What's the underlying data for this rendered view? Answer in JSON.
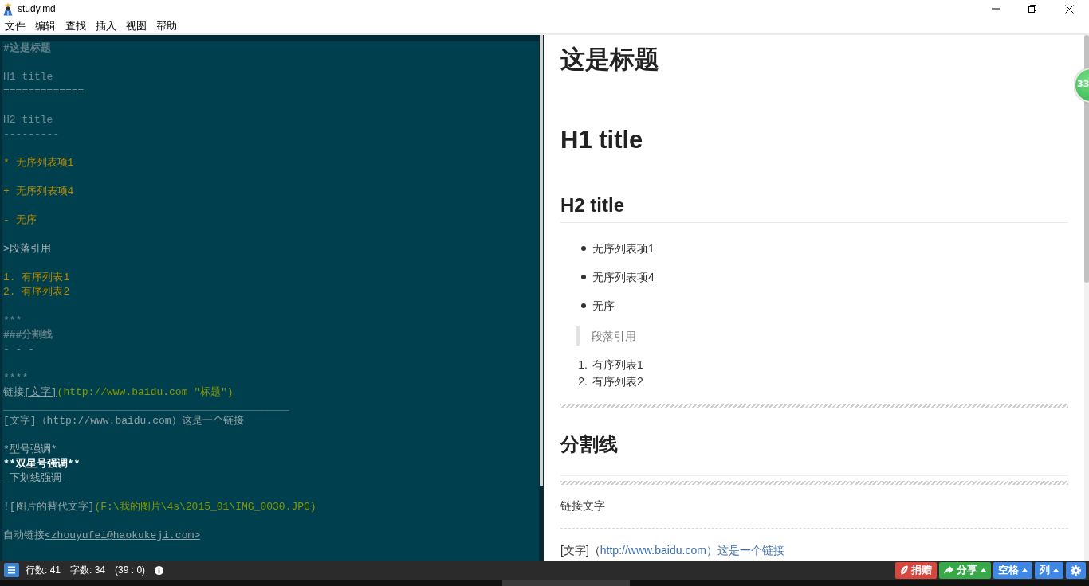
{
  "window": {
    "title": "study.md"
  },
  "menu": [
    "文件",
    "编辑",
    "查找",
    "插入",
    "视图",
    "帮助"
  ],
  "editor": {
    "lines": [
      {
        "kind": "code",
        "segments": [
          {
            "text": "#这是标题",
            "kind": "heading"
          }
        ]
      },
      {
        "kind": "blank"
      },
      {
        "kind": "code",
        "segments": [
          {
            "text": "H1 title",
            "kind": "setext"
          }
        ]
      },
      {
        "kind": "code",
        "segments": [
          {
            "text": "=============",
            "kind": "setext"
          }
        ]
      },
      {
        "kind": "blank"
      },
      {
        "kind": "code",
        "segments": [
          {
            "text": "H2 title",
            "kind": "setext"
          }
        ]
      },
      {
        "kind": "code",
        "segments": [
          {
            "text": "---------",
            "kind": "setext"
          }
        ]
      },
      {
        "kind": "blank"
      },
      {
        "kind": "code",
        "segments": [
          {
            "text": "* 无序列表项1",
            "kind": "list"
          }
        ]
      },
      {
        "kind": "blank"
      },
      {
        "kind": "code",
        "segments": [
          {
            "text": "+ 无序列表项4",
            "kind": "list"
          }
        ]
      },
      {
        "kind": "blank"
      },
      {
        "kind": "code",
        "segments": [
          {
            "text": "- 无序",
            "kind": "list"
          }
        ]
      },
      {
        "kind": "blank"
      },
      {
        "kind": "code",
        "segments": [
          {
            "text": ">段落引用",
            "kind": "quote"
          }
        ]
      },
      {
        "kind": "blank"
      },
      {
        "kind": "code",
        "segments": [
          {
            "text": "1. 有序列表1",
            "kind": "list"
          }
        ]
      },
      {
        "kind": "code",
        "segments": [
          {
            "text": "2. 有序列表2",
            "kind": "list"
          }
        ]
      },
      {
        "kind": "blank"
      },
      {
        "kind": "code",
        "segments": [
          {
            "text": "***",
            "kind": "rule"
          }
        ]
      },
      {
        "kind": "code",
        "segments": [
          {
            "text": "###分割线",
            "kind": "heading"
          }
        ]
      },
      {
        "kind": "code",
        "segments": [
          {
            "text": "- - -",
            "kind": "rule"
          }
        ]
      },
      {
        "kind": "blank"
      },
      {
        "kind": "code",
        "segments": [
          {
            "text": "****",
            "kind": "rule"
          }
        ]
      },
      {
        "kind": "code",
        "segments": [
          {
            "text": "链接",
            "kind": "text"
          },
          {
            "text": "[文字]",
            "kind": "label"
          },
          {
            "text": "(http://www.baidu.com \"标题\")",
            "kind": "url"
          }
        ]
      },
      {
        "kind": "code",
        "segments": [
          {
            "text": "______________________________________________",
            "kind": "rule"
          }
        ]
      },
      {
        "kind": "code",
        "segments": [
          {
            "text": "[文字]（http://www.baidu.com）这是一个链接",
            "kind": "text"
          }
        ]
      },
      {
        "kind": "blank"
      },
      {
        "kind": "code",
        "segments": [
          {
            "text": "*型号强调*",
            "kind": "emphasis"
          }
        ]
      },
      {
        "kind": "code",
        "segments": [
          {
            "text": "**双星号强调**",
            "kind": "strong"
          }
        ]
      },
      {
        "kind": "code",
        "segments": [
          {
            "text": "_下划线强调_",
            "kind": "emphasis"
          }
        ]
      },
      {
        "kind": "blank"
      },
      {
        "kind": "code",
        "segments": [
          {
            "text": "![图片的替代文字]",
            "kind": "text"
          },
          {
            "text": "(F:\\我的图片\\4s\\2015_01\\IMG_0030.JPG)",
            "kind": "url"
          }
        ]
      },
      {
        "kind": "blank"
      },
      {
        "kind": "code",
        "segments": [
          {
            "text": "自动链接",
            "kind": "text"
          },
          {
            "text": "<zhouyufei@haokukeji.com>",
            "kind": "label"
          }
        ]
      }
    ]
  },
  "preview": {
    "blocks": [
      {
        "kind": "h1",
        "text": "这是标题"
      },
      {
        "kind": "h1",
        "text": "H1 title"
      },
      {
        "kind": "h2",
        "text": "H2 title"
      },
      {
        "kind": "bullets",
        "items": [
          "无序列表项1",
          "无序列表项4",
          "无序"
        ]
      },
      {
        "kind": "quote",
        "text": "段落引用"
      },
      {
        "kind": "numbered",
        "items": [
          {
            "number": "1.",
            "text": "有序列表1"
          },
          {
            "number": "2.",
            "text": "有序列表2"
          }
        ]
      },
      {
        "kind": "hatched_rule"
      },
      {
        "kind": "h3",
        "text": "分割线"
      },
      {
        "kind": "thin_rule"
      },
      {
        "kind": "hatched_rule"
      },
      {
        "kind": "paragraph",
        "text": "链接文字"
      },
      {
        "kind": "dashed_rule"
      },
      {
        "kind": "link_paragraph",
        "text": "[文字]（",
        "link": "http://www.baidu.com）这是一个链接"
      }
    ],
    "badge": "33"
  },
  "status_bar": {
    "stats": [
      "行数: 41",
      "字数: 34",
      "(39 : 0)"
    ],
    "buttons": [
      {
        "kind": "donate",
        "label": "捐赠",
        "color": "#d8473d",
        "dropdown": false
      },
      {
        "kind": "share",
        "label": "分享",
        "color": "#38a948",
        "dropdown": true
      },
      {
        "kind": "indent",
        "label": "空格",
        "color": "#3f88e6",
        "dropdown": true
      },
      {
        "kind": "column",
        "label": "列",
        "color": "#3f88e6",
        "dropdown": true
      },
      {
        "kind": "settings",
        "color": "#3f88e6",
        "dropdown": false
      }
    ]
  }
}
